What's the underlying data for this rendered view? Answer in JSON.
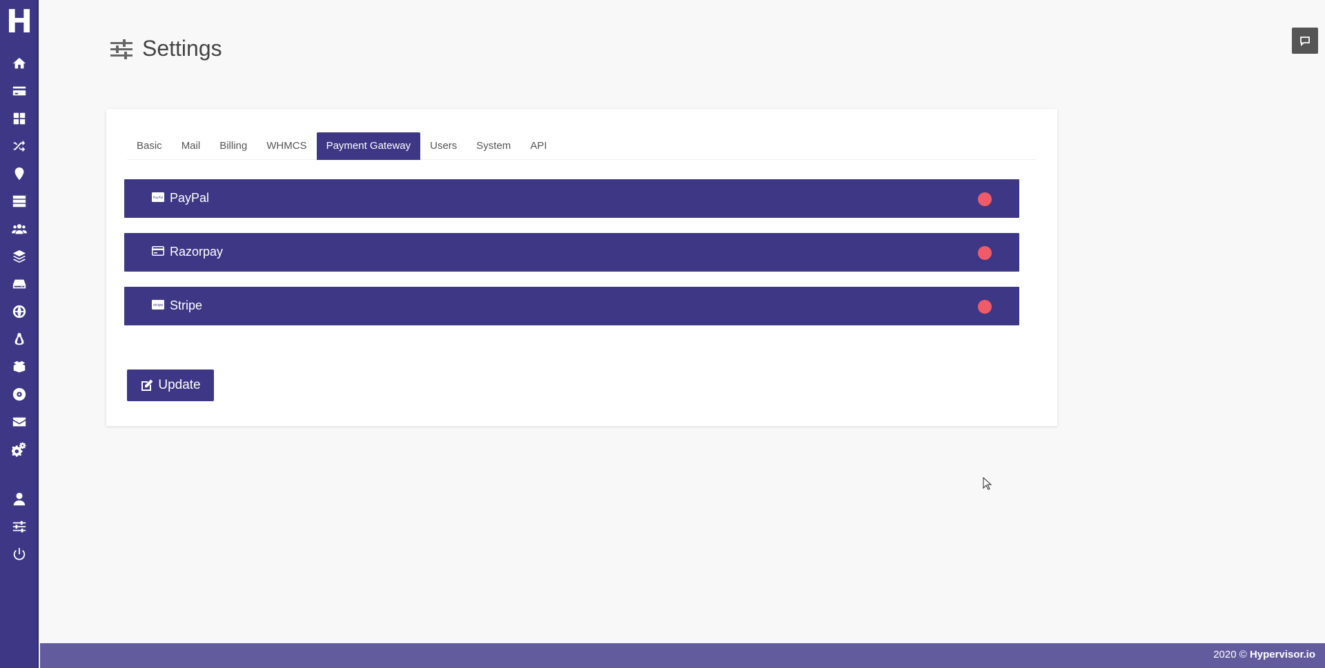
{
  "sidebar": {
    "logo": "H",
    "icons": [
      "home-icon",
      "credit-card-icon",
      "dashboard-icon",
      "shuffle-icon",
      "map-pin-icon",
      "server-icon",
      "users-icon",
      "layers-icon",
      "hard-drive-icon",
      "globe-icon",
      "linux-icon",
      "boxes-icon",
      "disc-icon",
      "mail-icon",
      "cogs-icon",
      "user-icon",
      "sliders-icon",
      "power-icon"
    ]
  },
  "header": {
    "title": "Settings"
  },
  "tabs": [
    {
      "label": "Basic"
    },
    {
      "label": "Mail"
    },
    {
      "label": "Billing"
    },
    {
      "label": "WHMCS"
    },
    {
      "label": "Payment Gateway",
      "active": true
    },
    {
      "label": "Users"
    },
    {
      "label": "System"
    },
    {
      "label": "API"
    }
  ],
  "gateways": [
    {
      "label": "PayPal",
      "icon": "paypal-icon",
      "status_color": "#ef5b67"
    },
    {
      "label": "Razorpay",
      "icon": "credit-card-icon",
      "status_color": "#ef5b67"
    },
    {
      "label": "Stripe",
      "icon": "stripe-icon",
      "status_color": "#ef5b67"
    }
  ],
  "actions": {
    "update_label": "Update"
  },
  "footer": {
    "year": "2020 ©",
    "brand": "Hypervisor.io"
  },
  "colors": {
    "primary": "#3d3785",
    "footer": "#625c9f",
    "status_off": "#ef5b67"
  }
}
